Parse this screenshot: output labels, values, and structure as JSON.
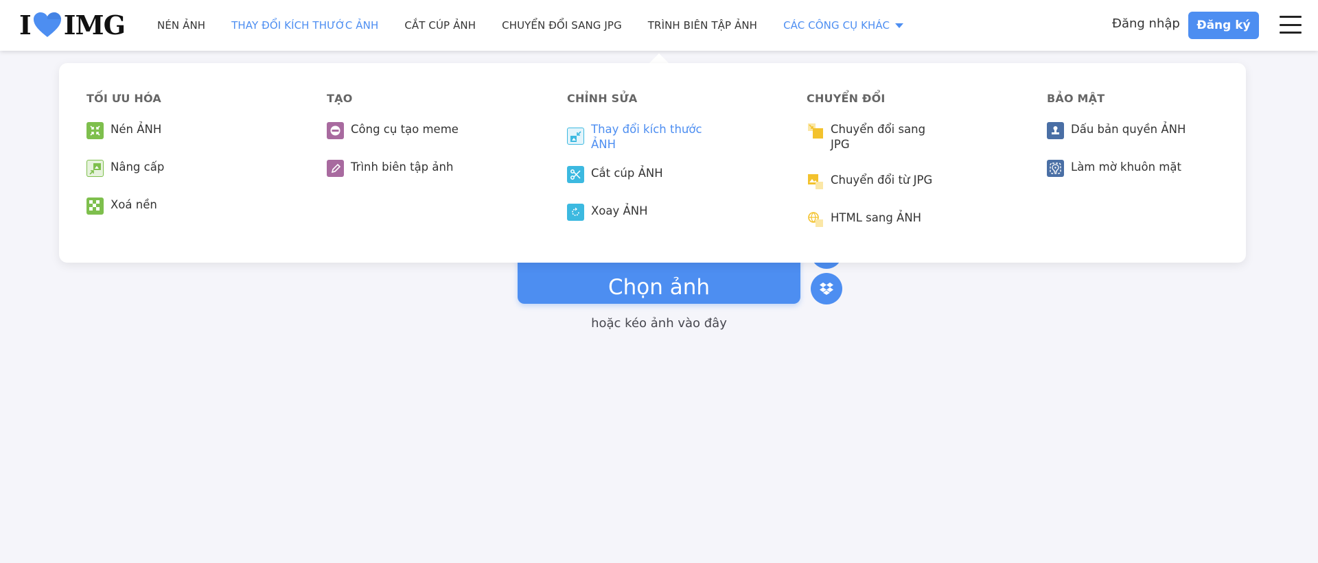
{
  "brand": {
    "left": "I",
    "right": "IMG"
  },
  "nav": {
    "items": [
      {
        "label": "NÉN ẢNH",
        "active": false
      },
      {
        "label": "THAY ĐỔI KÍCH THƯỚC ẢNH",
        "active": true
      },
      {
        "label": "CẮT CÚP ẢNH",
        "active": false
      },
      {
        "label": "CHUYỂN ĐỔI SANG JPG",
        "active": false
      },
      {
        "label": "TRÌNH BIÊN TẬP ẢNH",
        "active": false
      }
    ],
    "more_label": "CÁC CÔNG CỤ KHÁC"
  },
  "auth": {
    "login": "Đăng nhập",
    "signup": "Đăng ký"
  },
  "main": {
    "choose_label": "Chọn ảnh",
    "drop_hint": "hoặc kéo ảnh vào đây"
  },
  "mega_menu": {
    "columns": [
      {
        "title": "TỐI ƯU HÓA",
        "items": [
          {
            "label": "Nén ẢNH",
            "icon": "compress-icon",
            "color": "#7ebf4d"
          },
          {
            "label": "Nâng cấp",
            "icon": "upscale-icon",
            "color": "#7ebf4d"
          },
          {
            "label": "Xoá nền",
            "icon": "remove-background-icon",
            "color": "#7ebf4d"
          }
        ]
      },
      {
        "title": "TẠO",
        "items": [
          {
            "label": "Công cụ tạo meme",
            "icon": "meme-icon",
            "color": "#a86a9f"
          },
          {
            "label": "Trình biên tập ảnh",
            "icon": "pencil-icon",
            "color": "#a86a9f"
          }
        ]
      },
      {
        "title": "CHỈNH SỬA",
        "items": [
          {
            "label": "Thay đổi kích thước ẢNH",
            "icon": "resize-icon",
            "color": "#3cb9e0",
            "active": true
          },
          {
            "label": "Cắt cúp ẢNH",
            "icon": "crop-icon",
            "color": "#3cb9e0"
          },
          {
            "label": "Xoay ẢNH",
            "icon": "rotate-icon",
            "color": "#3cb9e0"
          }
        ]
      },
      {
        "title": "CHUYỂN ĐỔI",
        "items": [
          {
            "label": "Chuyển đổi sang JPG",
            "icon": "convert-to-jpg-icon",
            "color": "#f3c22d"
          },
          {
            "label": "Chuyển đổi từ JPG",
            "icon": "convert-from-jpg-icon",
            "color": "#f3c22d"
          },
          {
            "label": "HTML sang ẢNH",
            "icon": "html-to-image-icon",
            "color": "#f3c22d"
          }
        ]
      },
      {
        "title": "BẢO MẬT",
        "items": [
          {
            "label": "Dấu bản quyền ẢNH",
            "icon": "watermark-icon",
            "color": "#4a6fa5"
          },
          {
            "label": "Làm mờ khuôn mặt",
            "icon": "blur-face-icon",
            "color": "#4a6fa5"
          }
        ]
      }
    ]
  },
  "colors": {
    "accent": "#4d8ef1",
    "background": "#f5f5fa"
  }
}
